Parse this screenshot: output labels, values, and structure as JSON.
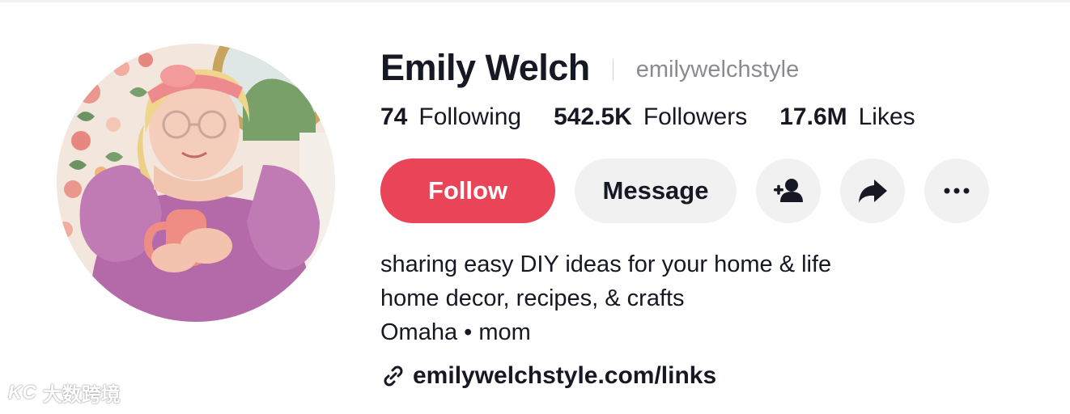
{
  "profile": {
    "display_name": "Emily Welch",
    "handle": "emilywelchstyle",
    "avatar_alt": "profile-photo"
  },
  "stats": [
    {
      "value": "74",
      "label": "Following"
    },
    {
      "value": "542.5K",
      "label": "Followers"
    },
    {
      "value": "17.6M",
      "label": "Likes"
    }
  ],
  "actions": {
    "follow_label": "Follow",
    "message_label": "Message",
    "add_friend_icon": "add-user-icon",
    "share_icon": "share-arrow-icon",
    "more_icon": "more-dots-icon"
  },
  "bio": {
    "lines": [
      "sharing easy DIY ideas for your home & life",
      "home decor, recipes, & crafts",
      "Omaha • mom"
    ]
  },
  "link": {
    "icon": "link-icon",
    "text": "emilywelchstyle.com/links"
  },
  "watermark": {
    "logo": "KC",
    "text": "大数跨境"
  },
  "colors": {
    "follow_bg": "#ea4459",
    "secondary_bg": "#f1f1f2",
    "text_primary": "#161823",
    "text_secondary": "#8a8b91"
  }
}
